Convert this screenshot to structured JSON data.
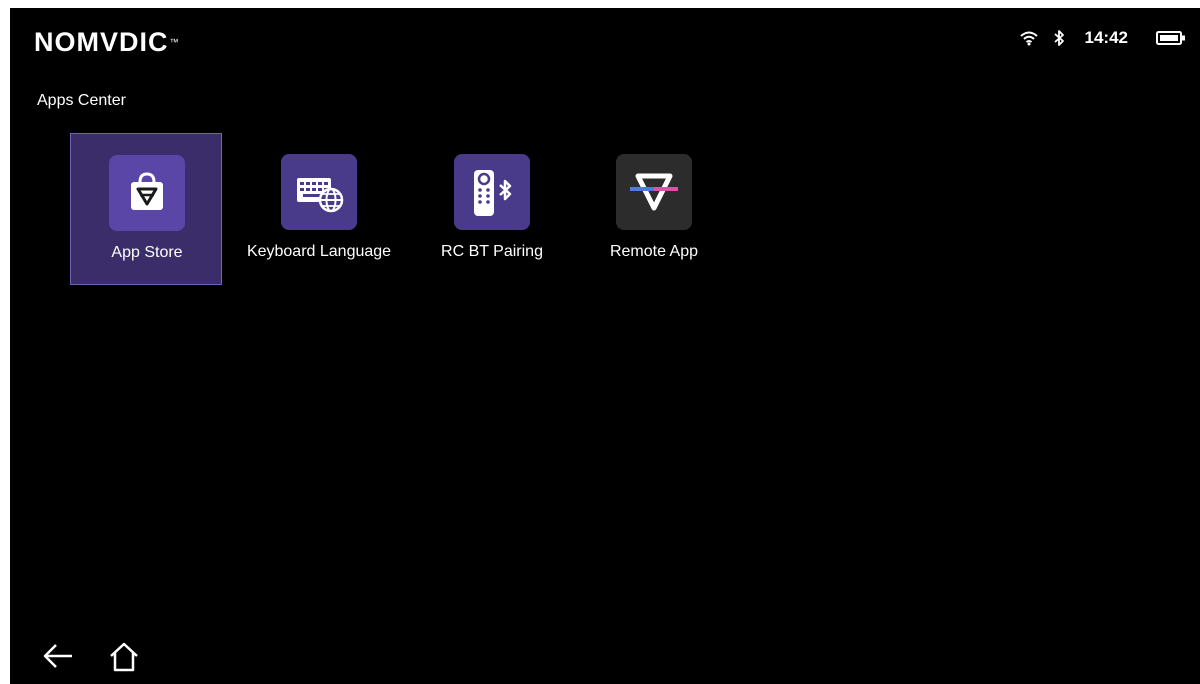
{
  "brand": {
    "logo_text": "NOMVDIC",
    "logo_mark": "™"
  },
  "status_bar": {
    "time": "14:42",
    "icons": [
      "wifi-icon",
      "bluetooth-icon",
      "battery-icon"
    ]
  },
  "section": {
    "title": "Apps Center"
  },
  "apps": [
    {
      "label": "App Store",
      "icon": "app-store-icon",
      "selected": true,
      "icon_bg": "#5a46a6"
    },
    {
      "label": "Keyboard Language",
      "icon": "keyboard-globe-icon",
      "selected": false,
      "icon_bg": "#4a3a8a"
    },
    {
      "label": "RC BT Pairing",
      "icon": "remote-bluetooth-icon",
      "selected": false,
      "icon_bg": "#4a3a8a"
    },
    {
      "label": "Remote App",
      "icon": "remote-app-icon",
      "selected": false,
      "icon_bg": "#2c2c2c"
    }
  ],
  "navigation": {
    "back": "back-arrow-icon",
    "home": "home-icon"
  },
  "colors": {
    "background": "#000000",
    "selection": "#3a2d6a",
    "accent": "#6f63b4"
  }
}
